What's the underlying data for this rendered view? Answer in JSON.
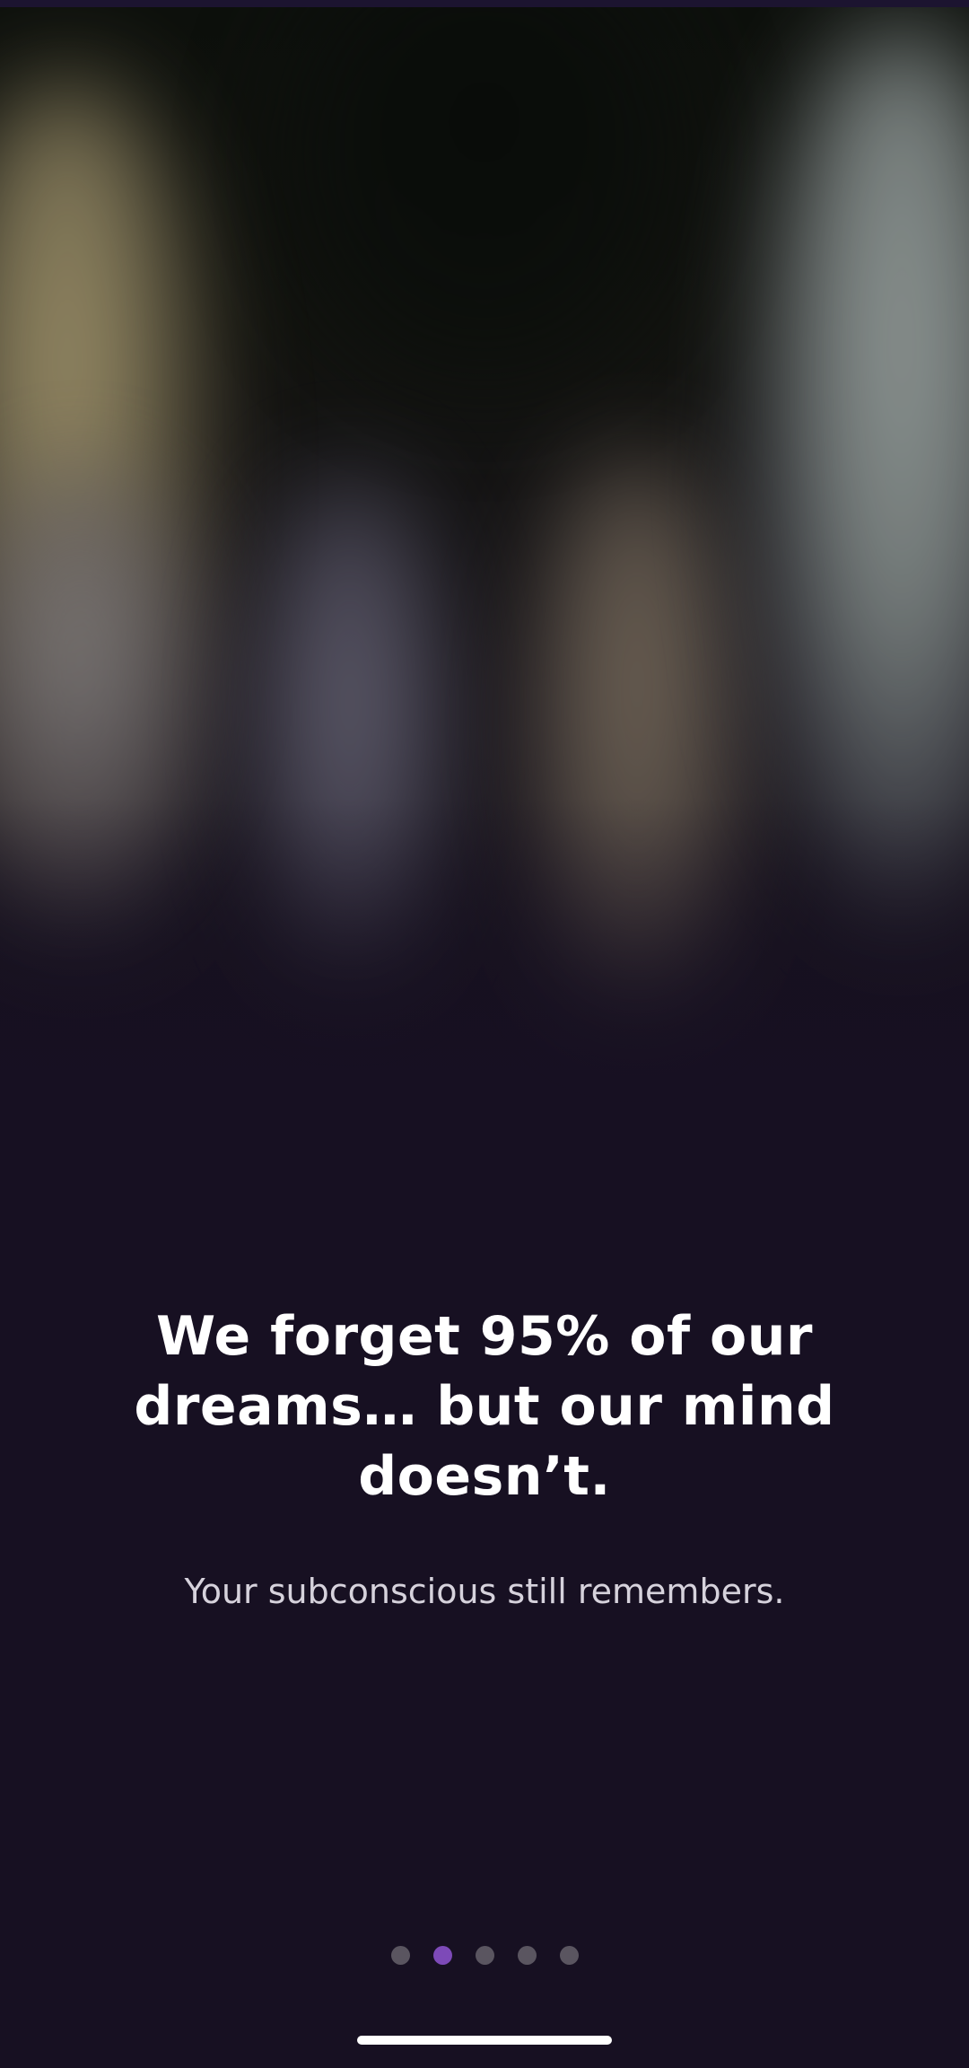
{
  "onboarding": {
    "headline": "We forget 95% of our dreams… but our mind doesn’t.",
    "subtitle": "Your subconscious still remembers.",
    "pager": {
      "total_pages": 5,
      "current_page": 2
    }
  },
  "colors": {
    "background": "#171022",
    "accent": "#7d4ab8",
    "inactive_dot": "#5a5560",
    "headline_text": "#ffffff",
    "subtitle_text": "#d6d2dc"
  }
}
